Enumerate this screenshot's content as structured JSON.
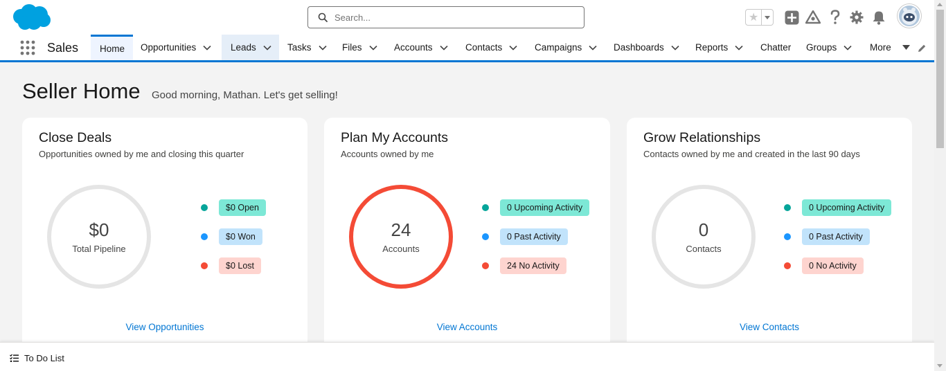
{
  "header": {
    "search_placeholder": "Search..."
  },
  "nav": {
    "app_name": "Sales",
    "tabs": [
      {
        "label": "Home"
      },
      {
        "label": "Opportunities"
      },
      {
        "label": "Leads"
      },
      {
        "label": "Tasks"
      },
      {
        "label": "Files"
      },
      {
        "label": "Accounts"
      },
      {
        "label": "Contacts"
      },
      {
        "label": "Campaigns"
      },
      {
        "label": "Dashboards"
      },
      {
        "label": "Reports"
      },
      {
        "label": "Chatter"
      },
      {
        "label": "Groups"
      },
      {
        "label": "More"
      }
    ]
  },
  "page": {
    "title": "Seller Home",
    "greeting": "Good morning, Mathan. Let's get selling!"
  },
  "cards": [
    {
      "title": "Close Deals",
      "subtitle": "Opportunities owned by me and closing this quarter",
      "ring_value": "$0",
      "ring_label": "Total Pipeline",
      "legend": [
        "$0 Open",
        "$0 Won",
        "$0 Lost"
      ],
      "link": "View Opportunities"
    },
    {
      "title": "Plan My Accounts",
      "subtitle": "Accounts owned by me",
      "ring_value": "24",
      "ring_label": "Accounts",
      "legend": [
        "0 Upcoming Activity",
        "0 Past Activity",
        "24 No Activity"
      ],
      "link": "View Accounts"
    },
    {
      "title": "Grow Relationships",
      "subtitle": "Contacts owned by me and created in the last 90 days",
      "ring_value": "0",
      "ring_label": "Contacts",
      "legend": [
        "0 Upcoming Activity",
        "0 Past Activity",
        "0 No Activity"
      ],
      "link": "View Contacts"
    }
  ],
  "footer": {
    "todo_label": "To Do List"
  },
  "colors": {
    "brand": "#0176d3",
    "teal": "#06a59a",
    "blue": "#1b96ff",
    "red": "#f44b36"
  }
}
